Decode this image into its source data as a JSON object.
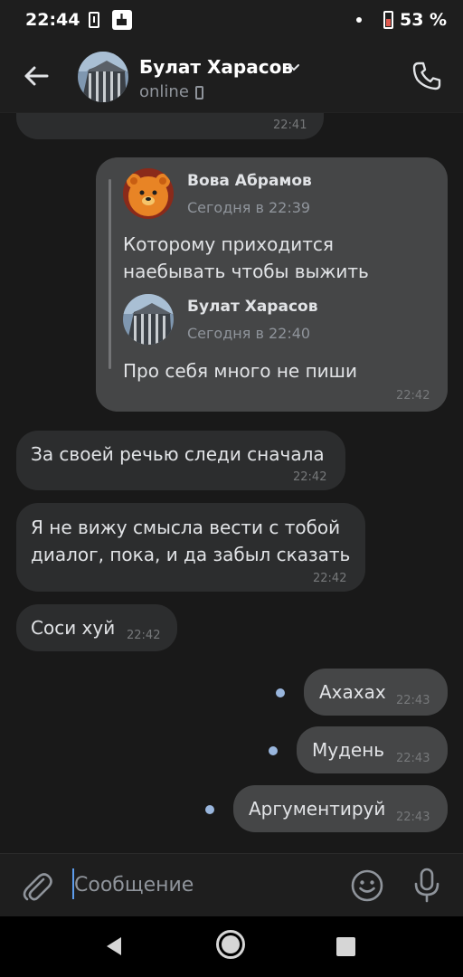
{
  "status_bar": {
    "time": "22:44",
    "battery": "53 %"
  },
  "header": {
    "contact_name": "Булат Харасов",
    "status": "online"
  },
  "messages": [
    {
      "dir": "in",
      "partial": true,
      "time": "22:41"
    },
    {
      "dir": "out",
      "time": "22:42",
      "forwards": [
        {
          "author": "Вова Абрамов",
          "date": "Сегодня в 22:39",
          "lines": [
            "Которому приходится",
            "наебывать чтобы выжить"
          ]
        },
        {
          "author": "Булат Харасов",
          "date": "Сегодня в 22:40",
          "lines": [
            "Про себя много не пиши"
          ]
        }
      ]
    },
    {
      "dir": "in",
      "lines": [
        "За своей речью следи сначала"
      ],
      "time": "22:42"
    },
    {
      "dir": "in",
      "lines": [
        "Я не вижу смысла вести с тобой",
        "диалог, пока, и да забыл сказать"
      ],
      "time": "22:42"
    },
    {
      "dir": "in",
      "lines": [
        "Соси хуй"
      ],
      "time": "22:42"
    },
    {
      "dir": "out",
      "lines": [
        "Ахахах"
      ],
      "time": "22:43",
      "unread": true
    },
    {
      "dir": "out",
      "lines": [
        "Мудень"
      ],
      "time": "22:43",
      "unread": true
    },
    {
      "dir": "out",
      "lines": [
        "Аргументируй"
      ],
      "time": "22:43",
      "unread": true
    }
  ],
  "composer": {
    "placeholder": "Сообщение"
  },
  "colors": {
    "background": "#191919",
    "incoming_bubble": "#2c2d2e",
    "outgoing_bubble": "#454647",
    "unread_dot": "#99b6dd",
    "text": "#e1e3e6",
    "secondary_text": "#8f949b"
  },
  "icons": [
    "back-arrow-icon",
    "chevron-down-icon",
    "phone-call-icon",
    "paperclip-icon",
    "emoji-icon",
    "microphone-icon"
  ]
}
